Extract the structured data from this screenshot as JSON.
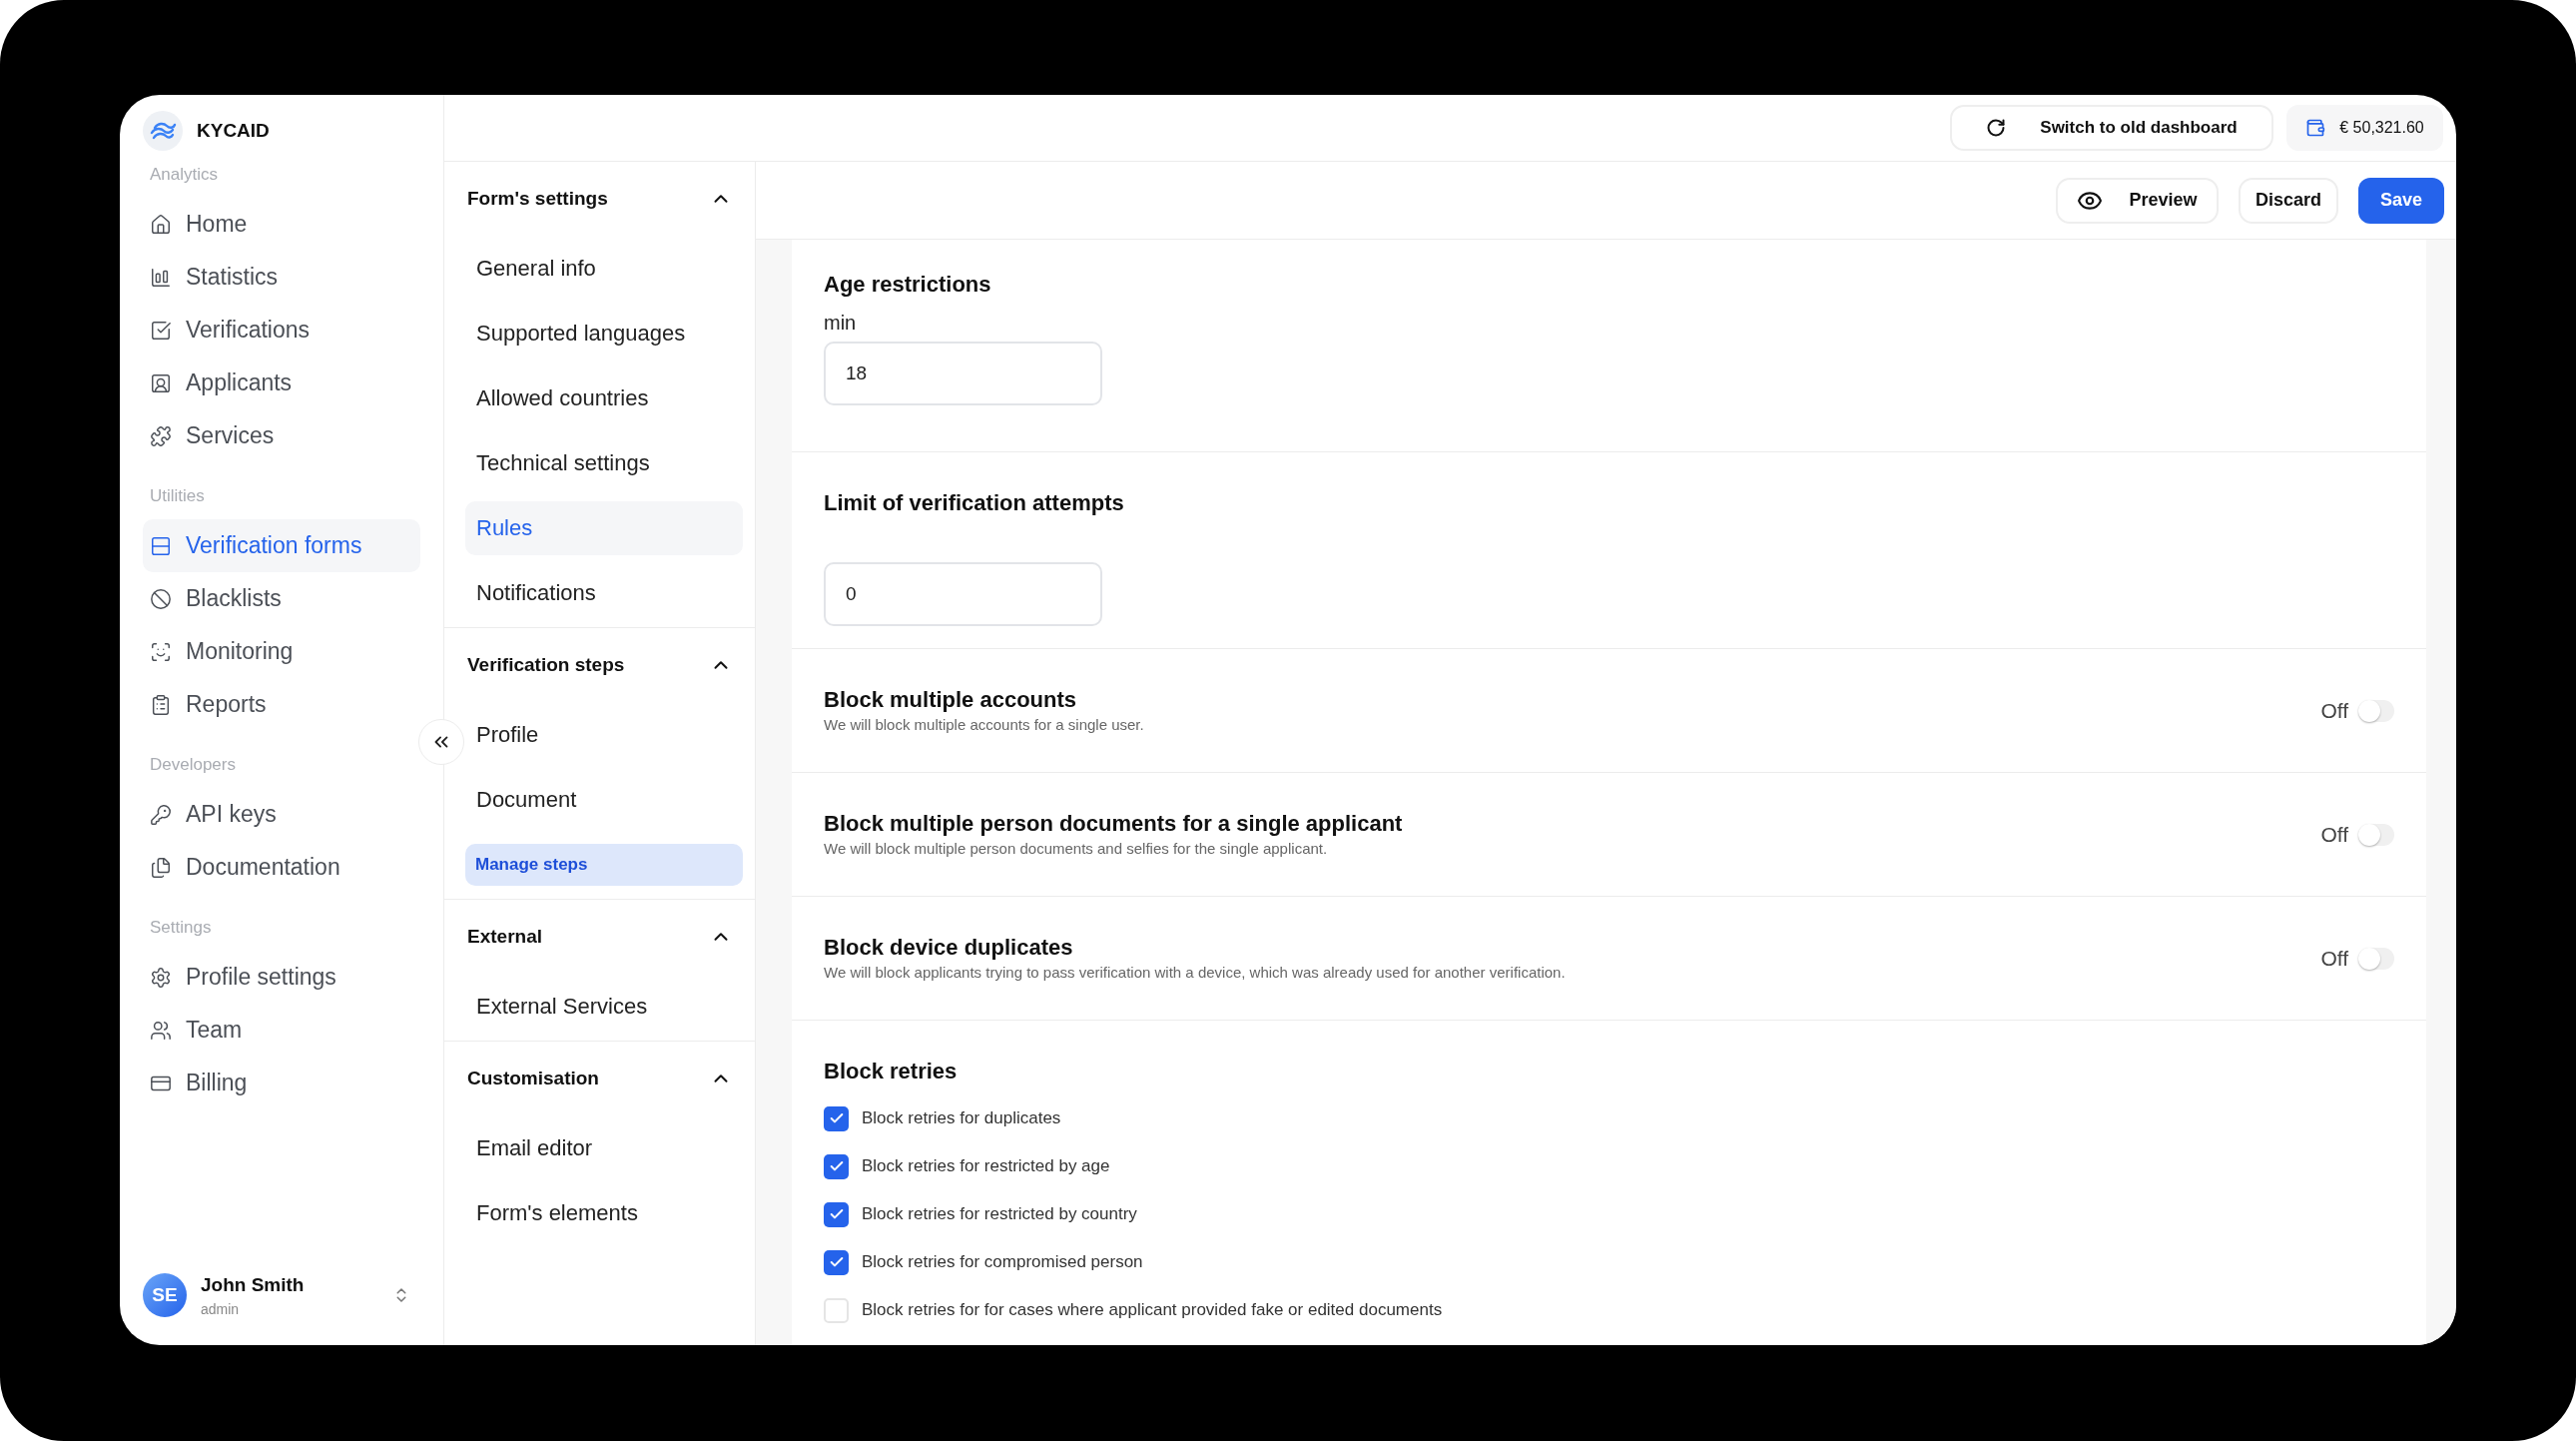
{
  "brand": {
    "name": "KYCAID"
  },
  "sidebar": {
    "sections": [
      {
        "label": "Analytics",
        "items": [
          {
            "label": "Home",
            "selected": false
          },
          {
            "label": "Statistics",
            "selected": false
          },
          {
            "label": "Verifications",
            "selected": false
          },
          {
            "label": "Applicants",
            "selected": false
          },
          {
            "label": "Services",
            "selected": false
          }
        ]
      },
      {
        "label": "Utilities",
        "items": [
          {
            "label": "Verification forms",
            "selected": true
          },
          {
            "label": "Blacklists",
            "selected": false
          },
          {
            "label": "Monitoring",
            "selected": false
          },
          {
            "label": "Reports",
            "selected": false
          }
        ]
      },
      {
        "label": "Developers",
        "items": [
          {
            "label": "API keys",
            "selected": false
          },
          {
            "label": "Documentation",
            "selected": false
          }
        ]
      },
      {
        "label": "Settings",
        "items": [
          {
            "label": "Profile settings",
            "selected": false
          },
          {
            "label": "Team",
            "selected": false
          },
          {
            "label": "Billing",
            "selected": false
          }
        ]
      }
    ]
  },
  "user": {
    "initials": "SE",
    "name": "John Smith",
    "role": "admin"
  },
  "topbar": {
    "switch_button": "Switch to old dashboard",
    "balance": "€ 50,321.60"
  },
  "actions": {
    "preview": "Preview",
    "discard": "Discard",
    "save": "Save"
  },
  "subnav": {
    "groups": [
      {
        "title": "Form's settings",
        "expanded": true,
        "items": [
          {
            "label": "General info",
            "kind": "link",
            "selected": false
          },
          {
            "label": "Supported languages",
            "kind": "link",
            "selected": false
          },
          {
            "label": "Allowed countries",
            "kind": "link",
            "selected": false
          },
          {
            "label": "Technical settings",
            "kind": "link",
            "selected": false
          },
          {
            "label": "Rules",
            "kind": "link",
            "selected": true
          },
          {
            "label": "Notifications",
            "kind": "link",
            "selected": false
          }
        ]
      },
      {
        "title": "Verification steps",
        "expanded": true,
        "items": [
          {
            "label": "Profile",
            "kind": "link",
            "selected": false
          },
          {
            "label": "Document",
            "kind": "link",
            "selected": false
          },
          {
            "label": "Manage steps",
            "kind": "action",
            "selected": false
          }
        ]
      },
      {
        "title": "External",
        "expanded": true,
        "items": [
          {
            "label": "External Services",
            "kind": "link",
            "selected": false
          }
        ]
      },
      {
        "title": "Customisation",
        "expanded": true,
        "items": [
          {
            "label": "Email editor",
            "kind": "link",
            "selected": false
          },
          {
            "label": "Form's elements",
            "kind": "link",
            "selected": false
          }
        ]
      }
    ]
  },
  "sections": [
    {
      "kind": "number",
      "title": "Age restrictions",
      "field_label": "min",
      "value": "18"
    },
    {
      "kind": "number",
      "title": "Limit of verification attempts",
      "value": "0"
    },
    {
      "kind": "toggle",
      "title": "Block multiple accounts",
      "description": "We will block multiple accounts for a single user.",
      "reading": "Off",
      "on": false
    },
    {
      "kind": "toggle",
      "title": "Block multiple person documents for a single applicant",
      "description": "We will block multiple person documents and selfies for the single applicant.",
      "reading": "Off",
      "on": false
    },
    {
      "kind": "toggle",
      "title": "Block device duplicates",
      "description": "We will block applicants trying to pass verification with a device, which was already used for another verification.",
      "reading": "Off",
      "on": false
    },
    {
      "kind": "checklist",
      "title": "Block retries",
      "options": [
        {
          "label": "Block retries for duplicates",
          "checked": true
        },
        {
          "label": "Block retries for restricted by age",
          "checked": true
        },
        {
          "label": "Block retries for restricted by country",
          "checked": true
        },
        {
          "label": "Block retries for compromised person",
          "checked": true
        },
        {
          "label": "Block retries for for cases where applicant provided fake or edited documents",
          "checked": false
        }
      ]
    }
  ]
}
